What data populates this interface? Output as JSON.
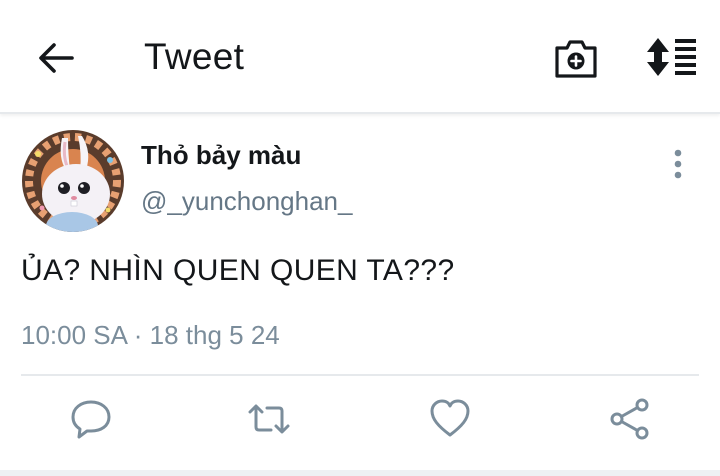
{
  "header": {
    "title": "Tweet",
    "back_icon": "arrow-left-icon",
    "camera_icon": "camera-plus-icon",
    "sort_icon": "sort-icon"
  },
  "tweet": {
    "display_name": "Thỏ bảy màu",
    "username": "@_yunchonghan_",
    "text": "ỦA? NHÌN QUEN QUEN TA???",
    "timestamp": "10:00 SA · 18 thg 5 24"
  },
  "actions": [
    "reply-icon",
    "retweet-icon",
    "like-icon",
    "share-icon"
  ],
  "colors": {
    "text": "#14171a",
    "secondary": "#657786",
    "icon": "#7b8d9b",
    "divider": "#e6e9ec"
  }
}
